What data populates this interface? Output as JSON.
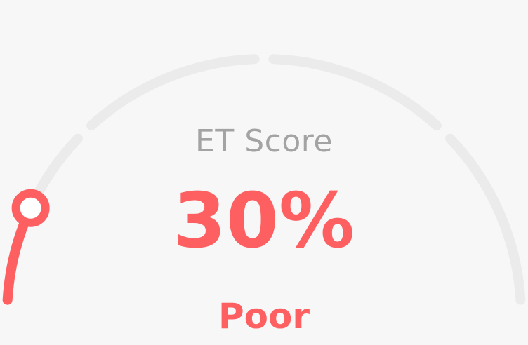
{
  "gauge": {
    "label": "ET Score",
    "value_text": "30%",
    "value_fraction": 0.3,
    "rating": "Poor",
    "segments": 4,
    "colors": {
      "background": "#f7f7f7",
      "track": "#ebebeb",
      "accent": "#fe5f61",
      "label": "#a3a3a3",
      "knob_fill": "#ffffff"
    }
  }
}
